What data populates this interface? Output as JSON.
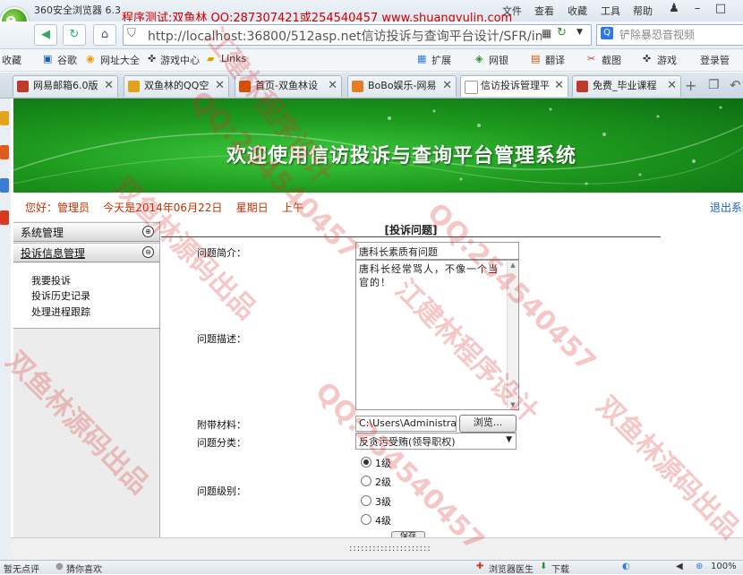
{
  "browser": {
    "name": "360安全浏览器 6.3",
    "promo": "程序测试:双鱼林 QQ:287307421或254540457 www.shuangyulin.com",
    "menu": [
      "文件",
      "查看",
      "收藏",
      "工具",
      "帮助"
    ],
    "url": "http://localhost:36800/512asp.net信访投诉与查询平台设计/SFR/inde",
    "search_text": "铲除暴恐音视频"
  },
  "bookmarks": [
    "收藏",
    "谷歌",
    "网址大全",
    "游戏中心",
    "Links",
    "扩展",
    "网银",
    "翻译",
    "截图",
    "游戏",
    "登录管"
  ],
  "tabs": [
    {
      "label": "网易邮箱6.0版",
      "color": "#c0392b",
      "active": false
    },
    {
      "label": "双鱼林的QQ空",
      "color": "#e3a21a",
      "active": false
    },
    {
      "label": "首页-双鱼林设",
      "color": "#d35400",
      "active": false
    },
    {
      "label": "BoBo娱乐-网易",
      "color": "#e67e22",
      "active": false
    },
    {
      "label": "信访投诉管理平",
      "color": "#7f8c8d",
      "active": true
    },
    {
      "label": "免费_毕业课程",
      "color": "#c0392b",
      "active": false
    }
  ],
  "page": {
    "banner_title": "欢迎使用信访投诉与查询平台管理系统",
    "greeting": "您好：管理员    今天是2014年06月22日    星期日    上午",
    "logout": "退出系统"
  },
  "sidebar": {
    "sections": [
      {
        "title": "系统管理"
      },
      {
        "title": "投诉信息管理"
      }
    ],
    "links": [
      "我要投诉",
      "投诉历史记录",
      "处理进程跟踪"
    ]
  },
  "form": {
    "title": "[投诉问题]",
    "summary_label": "问题简介：",
    "summary_value": "唐科长素质有问题",
    "desc_label": "问题描述：",
    "desc_value": "唐科长经常骂人，不像一个当官的！",
    "attach_label": "附带材料：",
    "attach_value": "C:\\Users\\Administrato",
    "browse_label": "浏览...",
    "category_label": "问题分类：",
    "category_value": "反贪污受贿(领导职权)",
    "level_label": "问题级别：",
    "levels": [
      "1级",
      "2级",
      "3级",
      "4级"
    ],
    "selected_level": "1级",
    "submit_label": "保存"
  },
  "status": {
    "left": [
      "暂无点评",
      "猜你喜欢"
    ],
    "right": [
      "浏览器医生",
      "下载",
      "100%"
    ],
    "dots": ":::::::::::::::::::::"
  },
  "watermark": {
    "texts": [
      "江建林程序设计",
      "QQ:254540457",
      "双鱼林源码出品",
      "江建林程序设计",
      "QQ:254540457",
      "双鱼林源码出品",
      "QQ:254540457",
      "双鱼林源码出品"
    ]
  }
}
